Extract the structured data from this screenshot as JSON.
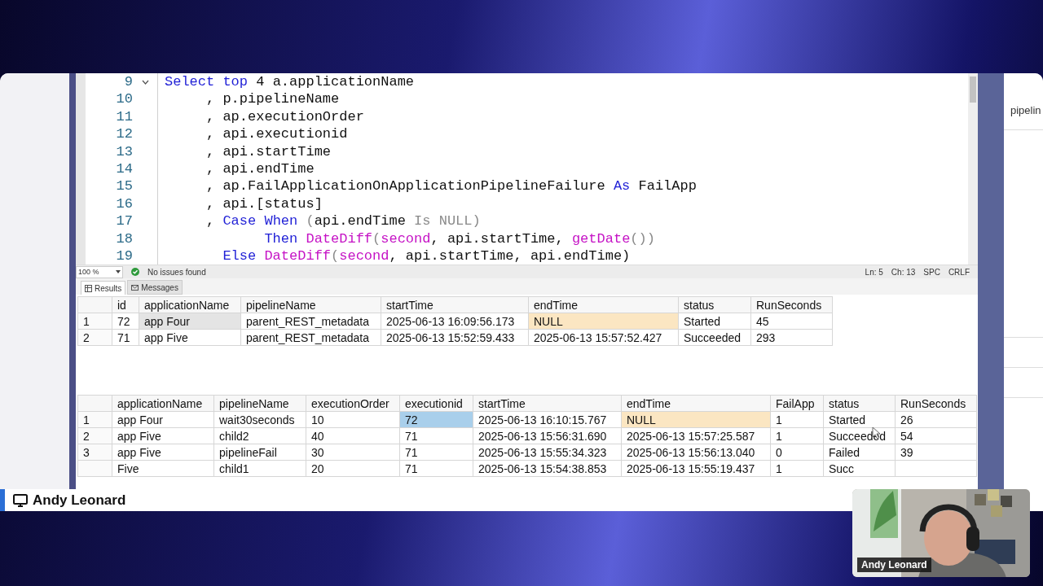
{
  "editor": {
    "lines": [
      {
        "number": "9",
        "fold": true,
        "tokens": [
          {
            "text": "Select top",
            "kind": "keyword"
          },
          {
            "text": " 4 a.applicationName",
            "kind": "text"
          }
        ]
      },
      {
        "number": "10",
        "fold": false,
        "tokens": [
          {
            "text": "     , p.pipelineName",
            "kind": "text"
          }
        ]
      },
      {
        "number": "11",
        "fold": false,
        "tokens": [
          {
            "text": "     , ap.executionOrder",
            "kind": "text"
          }
        ]
      },
      {
        "number": "12",
        "fold": false,
        "tokens": [
          {
            "text": "     , api.executionid",
            "kind": "text"
          }
        ]
      },
      {
        "number": "13",
        "fold": false,
        "tokens": [
          {
            "text": "     , api.startTime",
            "kind": "text"
          }
        ]
      },
      {
        "number": "14",
        "fold": false,
        "tokens": [
          {
            "text": "     , api.endTime",
            "kind": "text"
          }
        ]
      },
      {
        "number": "15",
        "fold": false,
        "tokens": [
          {
            "text": "     , ap.FailApplicationOnApplicationPipelineFailure ",
            "kind": "text"
          },
          {
            "text": "As",
            "kind": "keyword"
          },
          {
            "text": " FailApp",
            "kind": "text"
          }
        ]
      },
      {
        "number": "16",
        "fold": false,
        "tokens": [
          {
            "text": "     , api.[status]",
            "kind": "text"
          }
        ]
      },
      {
        "number": "17",
        "fold": false,
        "tokens": [
          {
            "text": "     , ",
            "kind": "text"
          },
          {
            "text": "Case When",
            "kind": "keyword"
          },
          {
            "text": " (",
            "kind": "operator"
          },
          {
            "text": "api.endTime ",
            "kind": "text"
          },
          {
            "text": "Is NULL)",
            "kind": "operator"
          }
        ]
      },
      {
        "number": "18",
        "fold": false,
        "tokens": [
          {
            "text": "            Then",
            "kind": "keyword"
          },
          {
            "text": " DateDiff",
            "kind": "function"
          },
          {
            "text": "(",
            "kind": "operator"
          },
          {
            "text": "second",
            "kind": "function"
          },
          {
            "text": ", api.startTime, ",
            "kind": "text"
          },
          {
            "text": "getDate",
            "kind": "function"
          },
          {
            "text": "())",
            "kind": "operator"
          }
        ]
      },
      {
        "number": "19",
        "fold": false,
        "tokens": [
          {
            "text": "       Else",
            "kind": "keyword"
          },
          {
            "text": " DateDiff",
            "kind": "function"
          },
          {
            "text": "(",
            "kind": "operator"
          },
          {
            "text": "second",
            "kind": "function"
          },
          {
            "text": ", api.startTime, api.endTime)",
            "kind": "text"
          }
        ]
      }
    ]
  },
  "status_bar": {
    "zoom": "100 %",
    "issues": "No issues found",
    "line": "Ln: 5",
    "column": "Ch: 13",
    "spacing": "SPC",
    "line_ending": "CRLF"
  },
  "result_tabs": [
    {
      "label": "Results",
      "selected": true
    },
    {
      "label": "Messages",
      "selected": false
    }
  ],
  "grids": [
    {
      "focused": false,
      "columns": [
        "id",
        "applicationName",
        "pipelineName",
        "startTime",
        "endTime",
        "status",
        "RunSeconds"
      ],
      "rows": [
        {
          "number": "1",
          "cells": [
            {
              "text": "72",
              "kind": "value",
              "selected": false
            },
            {
              "text": "app Four",
              "kind": "value",
              "selected": true
            },
            {
              "text": "parent_REST_metadata",
              "kind": "value",
              "selected": false
            },
            {
              "text": "2025-06-13 16:09:56.173",
              "kind": "value",
              "selected": false
            },
            {
              "text": "NULL",
              "kind": "null",
              "selected": false
            },
            {
              "text": "Started",
              "kind": "value",
              "selected": false
            },
            {
              "text": "45",
              "kind": "value",
              "selected": false
            }
          ]
        },
        {
          "number": "2",
          "cells": [
            {
              "text": "71",
              "kind": "value",
              "selected": false
            },
            {
              "text": "app Five",
              "kind": "value",
              "selected": false
            },
            {
              "text": "parent_REST_metadata",
              "kind": "value",
              "selected": false
            },
            {
              "text": "2025-06-13 15:52:59.433",
              "kind": "value",
              "selected": false
            },
            {
              "text": "2025-06-13 15:57:52.427",
              "kind": "value",
              "selected": false
            },
            {
              "text": "Succeeded",
              "kind": "value",
              "selected": false
            },
            {
              "text": "293",
              "kind": "value",
              "selected": false
            }
          ]
        }
      ]
    },
    {
      "focused": true,
      "columns": [
        "applicationName",
        "pipelineName",
        "executionOrder",
        "executionid",
        "startTime",
        "endTime",
        "FailApp",
        "status",
        "RunSeconds"
      ],
      "rows": [
        {
          "number": "1",
          "cells": [
            {
              "text": "app Four",
              "kind": "value",
              "selected": false
            },
            {
              "text": "wait30seconds",
              "kind": "value",
              "selected": false
            },
            {
              "text": "10",
              "kind": "value",
              "selected": false
            },
            {
              "text": "72",
              "kind": "value",
              "selected": true
            },
            {
              "text": "2025-06-13 16:10:15.767",
              "kind": "value",
              "selected": false
            },
            {
              "text": "NULL",
              "kind": "null",
              "selected": false
            },
            {
              "text": "1",
              "kind": "value",
              "selected": false
            },
            {
              "text": "Started",
              "kind": "value",
              "selected": false
            },
            {
              "text": "26",
              "kind": "value",
              "selected": false
            }
          ]
        },
        {
          "number": "2",
          "cells": [
            {
              "text": "app Five",
              "kind": "value",
              "selected": false
            },
            {
              "text": "child2",
              "kind": "value",
              "selected": false
            },
            {
              "text": "40",
              "kind": "value",
              "selected": false
            },
            {
              "text": "71",
              "kind": "value",
              "selected": false
            },
            {
              "text": "2025-06-13 15:56:31.690",
              "kind": "value",
              "selected": false
            },
            {
              "text": "2025-06-13 15:57:25.587",
              "kind": "value",
              "selected": false
            },
            {
              "text": "1",
              "kind": "value",
              "selected": false
            },
            {
              "text": "Succeeded",
              "kind": "value",
              "selected": false
            },
            {
              "text": "54",
              "kind": "value",
              "selected": false
            }
          ]
        },
        {
          "number": "3",
          "cells": [
            {
              "text": "app Five",
              "kind": "value",
              "selected": false
            },
            {
              "text": "pipelineFail",
              "kind": "value",
              "selected": false
            },
            {
              "text": "30",
              "kind": "value",
              "selected": false
            },
            {
              "text": "71",
              "kind": "value",
              "selected": false
            },
            {
              "text": "2025-06-13 15:55:34.323",
              "kind": "value",
              "selected": false
            },
            {
              "text": "2025-06-13 15:56:13.040",
              "kind": "value",
              "selected": false
            },
            {
              "text": "0",
              "kind": "value",
              "selected": false
            },
            {
              "text": "Failed",
              "kind": "value",
              "selected": false
            },
            {
              "text": "39",
              "kind": "value",
              "selected": false
            }
          ]
        },
        {
          "cells": [
            {
              "text": "Five",
              "kind": "value",
              "selected": false
            },
            {
              "text": "child1",
              "kind": "value",
              "selected": false
            },
            {
              "text": "20",
              "kind": "value",
              "selected": false
            },
            {
              "text": "71",
              "kind": "value",
              "selected": false
            },
            {
              "text": "2025-06-13 15:54:38.853",
              "kind": "value",
              "selected": false
            },
            {
              "text": "2025-06-13 15:55:19.437",
              "kind": "value",
              "selected": false
            },
            {
              "text": "1",
              "kind": "value",
              "selected": false
            },
            {
              "text": "Succ",
              "kind": "value",
              "selected": false
            }
          ]
        }
      ]
    }
  ],
  "side_panel": {
    "text": "pipelin"
  },
  "presenter_tag": {
    "name": "Andy Leonard"
  },
  "webcam": {
    "kind": "picture",
    "name": "Andy Leonard"
  }
}
